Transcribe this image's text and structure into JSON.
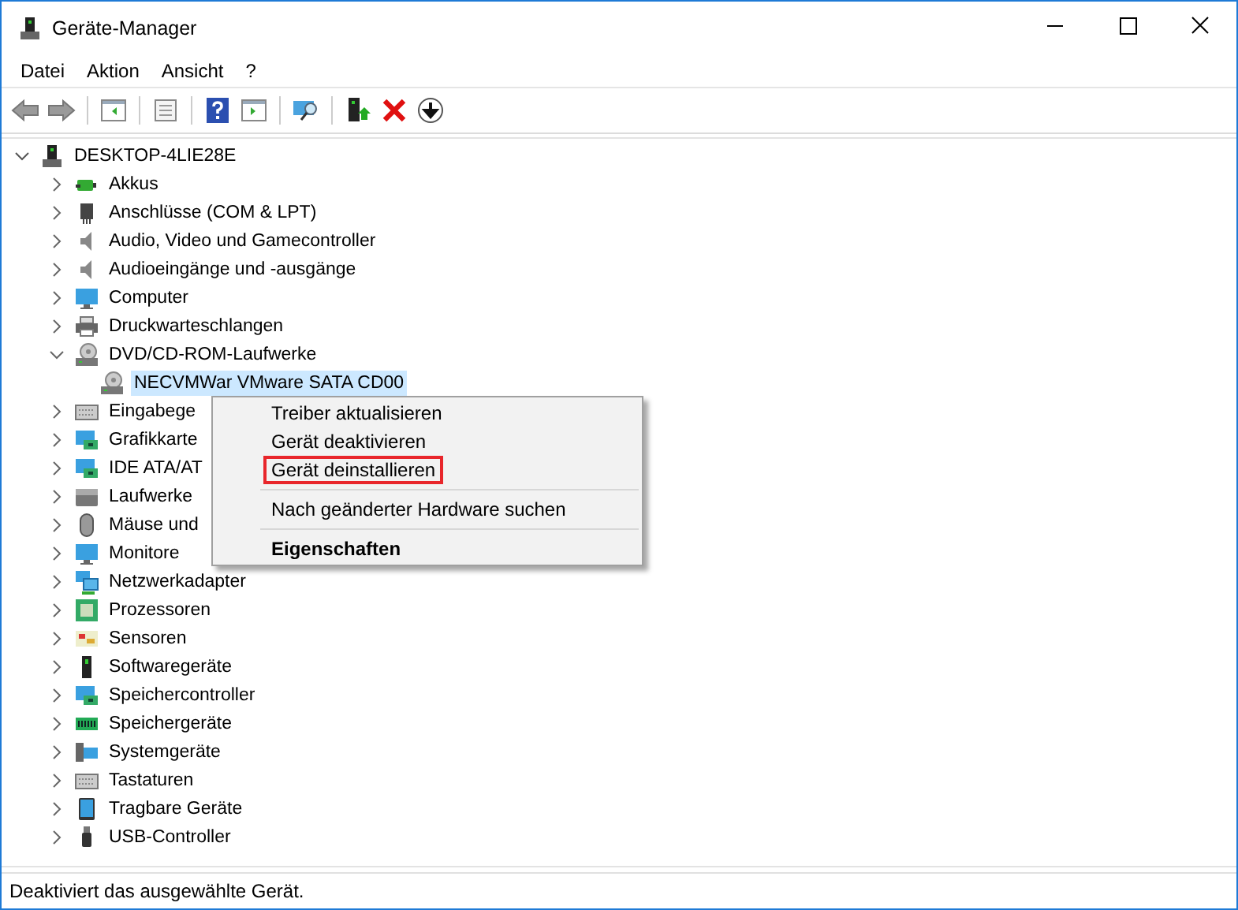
{
  "window": {
    "title": "Geräte-Manager"
  },
  "menu_bar": [
    "Datei",
    "Aktion",
    "Ansicht",
    "?"
  ],
  "tree": {
    "label": "DESKTOP-4LIE28E",
    "expanded": true,
    "children": [
      {
        "label": "Akkus",
        "expanded": false
      },
      {
        "label": "Anschlüsse (COM & LPT)",
        "expanded": false
      },
      {
        "label": "Audio, Video und Gamecontroller",
        "expanded": false
      },
      {
        "label": "Audioeingänge und -ausgänge",
        "expanded": false
      },
      {
        "label": "Computer",
        "expanded": false
      },
      {
        "label": "Druckwarteschlangen",
        "expanded": false
      },
      {
        "label": "DVD/CD-ROM-Laufwerke",
        "expanded": true,
        "children": [
          {
            "label": "NECVMWar VMware SATA CD00",
            "selected": true
          }
        ]
      },
      {
        "label": "Eingabege",
        "expanded": false
      },
      {
        "label": "Grafikkarte",
        "expanded": false
      },
      {
        "label": "IDE ATA/AT",
        "expanded": false
      },
      {
        "label": "Laufwerke",
        "expanded": false
      },
      {
        "label": "Mäuse und",
        "expanded": false
      },
      {
        "label": "Monitore",
        "expanded": false
      },
      {
        "label": "Netzwerkadapter",
        "expanded": false
      },
      {
        "label": "Prozessoren",
        "expanded": false
      },
      {
        "label": "Sensoren",
        "expanded": false
      },
      {
        "label": "Softwaregeräte",
        "expanded": false
      },
      {
        "label": "Speichercontroller",
        "expanded": false
      },
      {
        "label": "Speichergeräte",
        "expanded": false
      },
      {
        "label": "Systemgeräte",
        "expanded": false
      },
      {
        "label": "Tastaturen",
        "expanded": false
      },
      {
        "label": "Tragbare Geräte",
        "expanded": false
      },
      {
        "label": "USB-Controller",
        "expanded": false
      }
    ]
  },
  "context_menu": [
    {
      "kind": "item",
      "label": "Treiber aktualisieren",
      "default": false,
      "highlighted": false
    },
    {
      "kind": "item",
      "label": "Gerät deaktivieren",
      "default": false,
      "highlighted": false
    },
    {
      "kind": "item",
      "label": "Gerät deinstallieren",
      "default": false,
      "highlighted": true
    },
    {
      "kind": "separator"
    },
    {
      "kind": "item",
      "label": "Nach geänderter Hardware suchen",
      "default": false,
      "highlighted": false
    },
    {
      "kind": "separator"
    },
    {
      "kind": "item",
      "label": "Eigenschaften",
      "default": true,
      "highlighted": false
    }
  ],
  "status_bar": "Deaktiviert das ausgewählte Gerät."
}
